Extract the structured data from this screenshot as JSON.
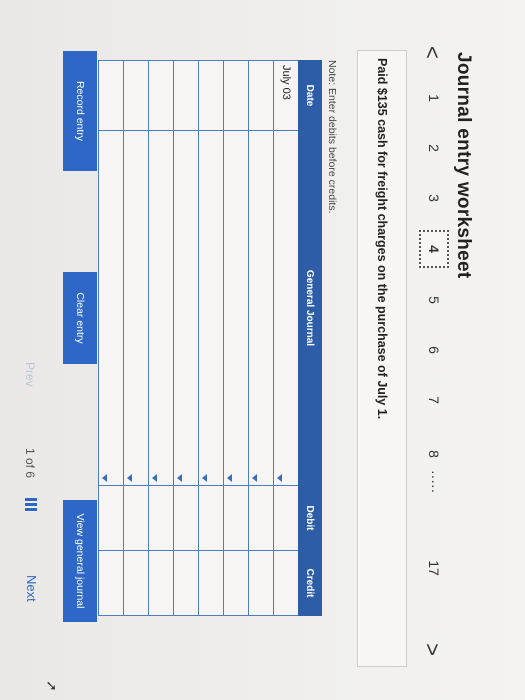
{
  "page": {
    "title": "Journal entry worksheet",
    "prompt": "Paid $135 cash for freight charges on the purchase of July 1.",
    "note": "Note: Enter debits before credits."
  },
  "nav": {
    "prev_arrow": "<",
    "next_arrow": ">",
    "steps": [
      "1",
      "2",
      "3",
      "4",
      "5",
      "6",
      "7",
      "8",
      "17"
    ],
    "dots": "·····",
    "active_step": "4"
  },
  "table": {
    "headers": {
      "date": "Date",
      "general_journal": "General Journal",
      "debit": "Debit",
      "credit": "Credit"
    },
    "rows": [
      {
        "date": "July 03",
        "account": "",
        "debit": "",
        "credit": ""
      },
      {
        "date": "",
        "account": "",
        "debit": "",
        "credit": ""
      },
      {
        "date": "",
        "account": "",
        "debit": "",
        "credit": ""
      },
      {
        "date": "",
        "account": "",
        "debit": "",
        "credit": ""
      },
      {
        "date": "",
        "account": "",
        "debit": "",
        "credit": ""
      },
      {
        "date": "",
        "account": "",
        "debit": "",
        "credit": ""
      },
      {
        "date": "",
        "account": "",
        "debit": "",
        "credit": ""
      },
      {
        "date": "",
        "account": "",
        "debit": "",
        "credit": ""
      }
    ]
  },
  "buttons": {
    "record": "Record entry",
    "clear": "Clear entry",
    "view": "View general journal"
  },
  "footer": {
    "prev": "Prev",
    "page": "1 of 6",
    "next": "Next"
  },
  "icons": {
    "prev": "chevron-left-icon",
    "next": "chevron-right-icon",
    "grid": "grid-icon"
  },
  "colors": {
    "header_blue": "#2e5da8",
    "button_blue": "#2e67c6",
    "grid_border": "#4f7ec0"
  }
}
